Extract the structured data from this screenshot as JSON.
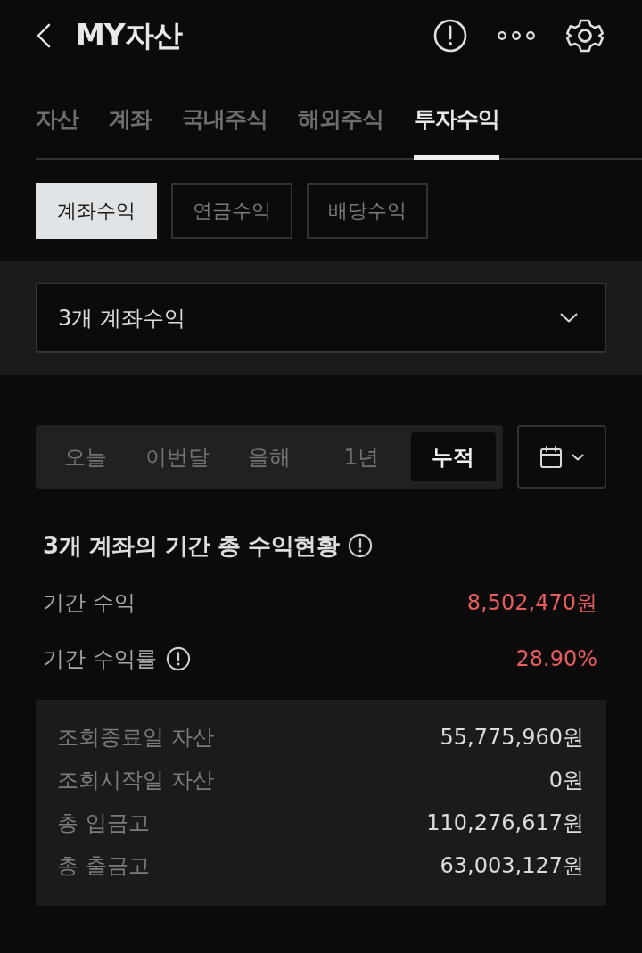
{
  "header": {
    "title": "MY자산"
  },
  "tabs": [
    {
      "label": "자산",
      "selected": false
    },
    {
      "label": "계좌",
      "selected": false
    },
    {
      "label": "국내주식",
      "selected": false
    },
    {
      "label": "해외주식",
      "selected": false
    },
    {
      "label": "투자수익",
      "selected": true
    }
  ],
  "sub_tabs": [
    {
      "label": "계좌수익",
      "selected": true
    },
    {
      "label": "연금수익",
      "selected": false
    },
    {
      "label": "배당수익",
      "selected": false
    }
  ],
  "account_select": {
    "value": "3개 계좌수익"
  },
  "period_tabs": [
    {
      "label": "오늘",
      "selected": false
    },
    {
      "label": "이번달",
      "selected": false
    },
    {
      "label": "올해",
      "selected": false
    },
    {
      "label": "1년",
      "selected": false
    },
    {
      "label": "누적",
      "selected": true
    }
  ],
  "summary": {
    "title": "3개 계좌의 기간 총 수익현황",
    "rows": [
      {
        "label": "기간 수익",
        "value": "8,502,470원",
        "info": false
      },
      {
        "label": "기간 수익률",
        "value": "28.90%",
        "info": true
      }
    ]
  },
  "details": [
    {
      "label": "조회종료일 자산",
      "value": "55,775,960원"
    },
    {
      "label": "조회시작일 자산",
      "value": "0원"
    },
    {
      "label": "총 입금고",
      "value": "110,276,617원"
    },
    {
      "label": "총 출금고",
      "value": "63,003,127원"
    }
  ]
}
